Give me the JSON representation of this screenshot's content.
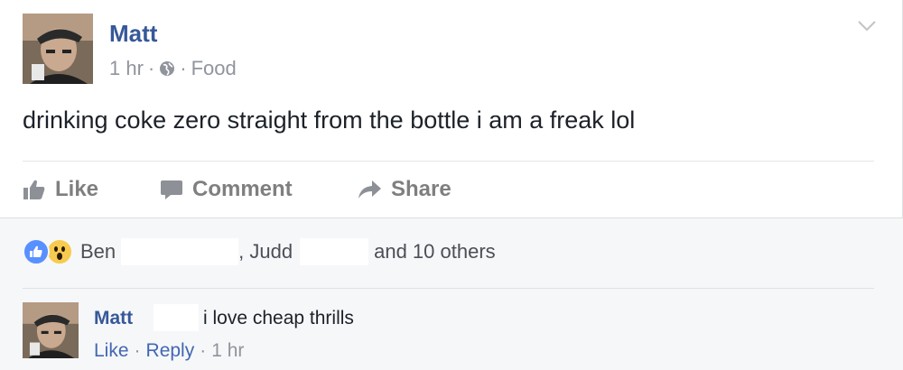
{
  "post": {
    "author": "Matt",
    "time": "1 hr",
    "separator": "·",
    "category": "Food",
    "text": "drinking coke zero straight from the bottle i am a freak lol"
  },
  "actions": {
    "like": "Like",
    "comment": "Comment",
    "share": "Share"
  },
  "reactions": {
    "types": [
      "like-icon",
      "wow-icon"
    ],
    "name1": "Ben",
    "name2": ", Judd",
    "others": "and 10 others"
  },
  "comment": {
    "author": "Matt",
    "text": "i love cheap thrills",
    "like": "Like",
    "separator": "·",
    "reply": "Reply",
    "time": "1 hr"
  },
  "colors": {
    "link": "#365899",
    "muted": "#90949c",
    "like_reaction": "#5890ff",
    "wow_reaction": "#f7cb4d"
  }
}
